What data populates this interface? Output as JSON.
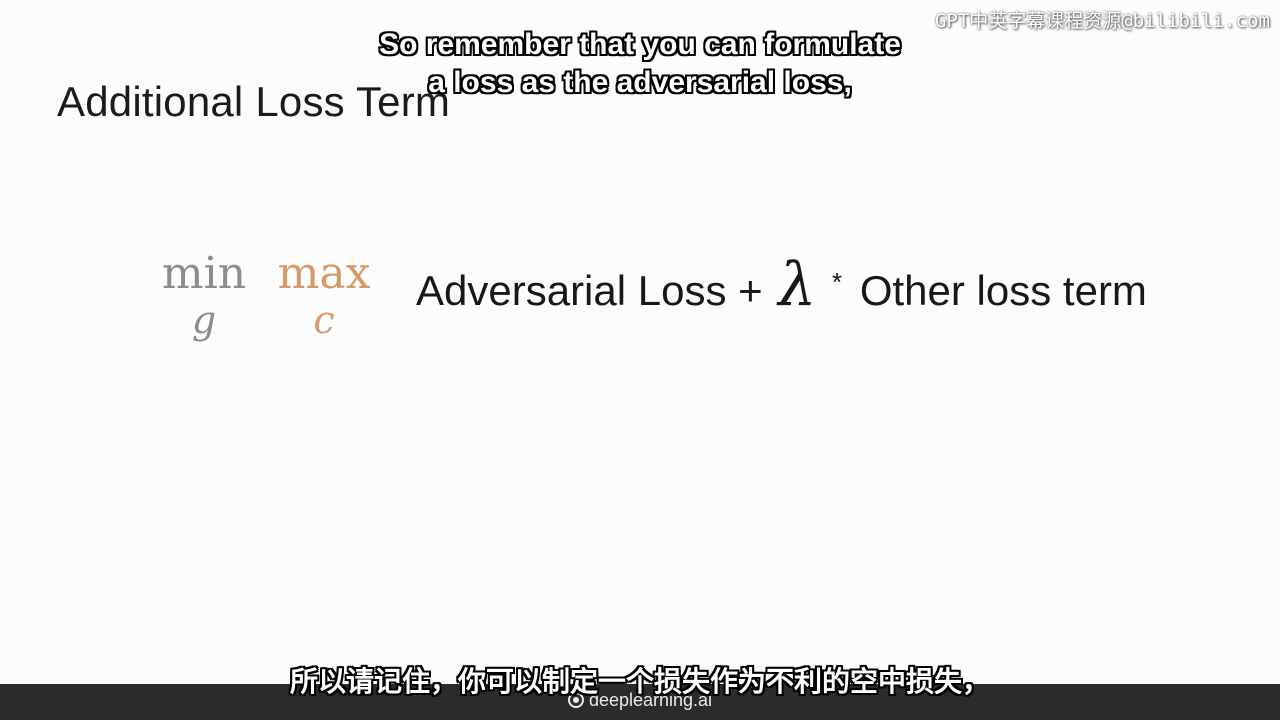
{
  "slide": {
    "title": "Additional Loss Term",
    "formula": {
      "min_word": "min",
      "min_sub": "g",
      "max_word": "max",
      "max_sub": "c",
      "term1": "Adversarial Loss +",
      "lambda": "λ",
      "star": "*",
      "term2": "Other loss term"
    }
  },
  "watermark": {
    "line1": "GPT中英字幕课程资源@bilibili.com"
  },
  "subtitles": {
    "english": "So remember that you can formulate\na loss as the adversarial loss,",
    "chinese": "所以请记住，你可以制定一个损失作为不利的空中损失，"
  },
  "footer": {
    "brand": "deeplearning.ai"
  },
  "colors": {
    "min_gray": "#8d8d8d",
    "max_orange": "#d49b6a",
    "footer_bar": "#2b2b2b"
  }
}
